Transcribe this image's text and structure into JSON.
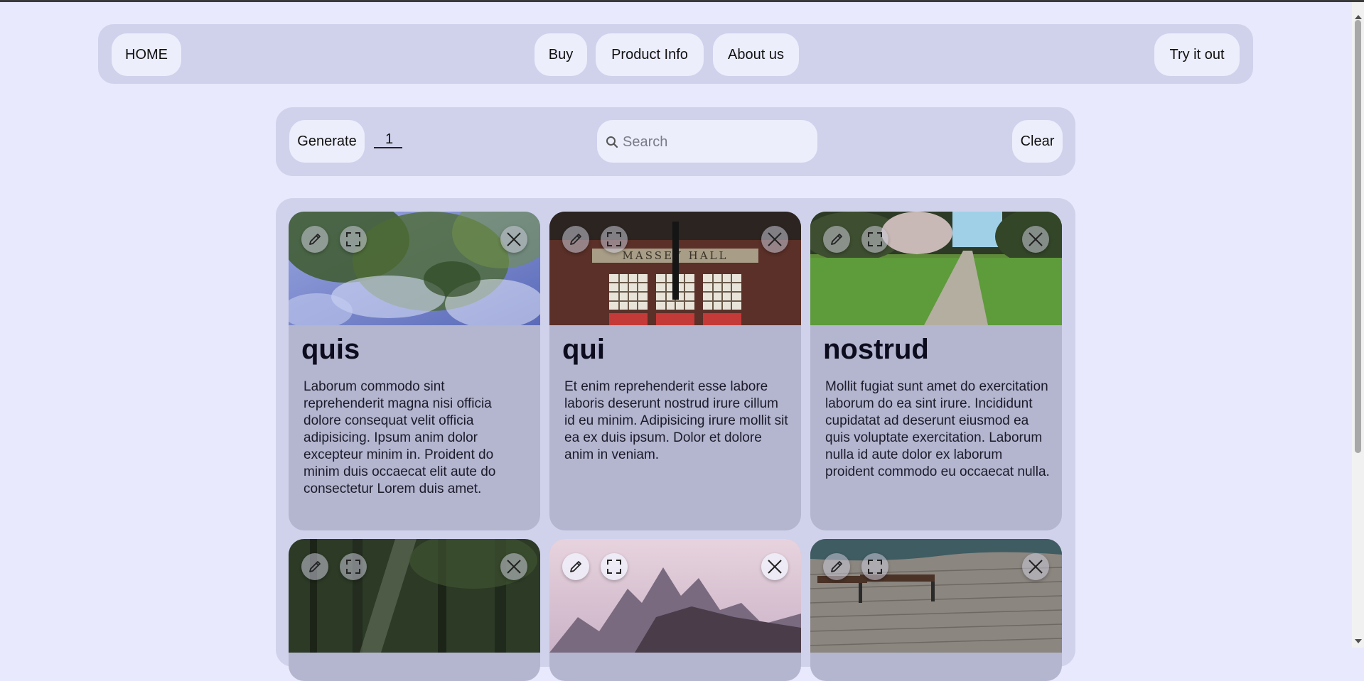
{
  "nav": {
    "home": "HOME",
    "buy": "Buy",
    "product_info": "Product Info",
    "about": "About us",
    "try": "Try it out"
  },
  "toolbar": {
    "generate_label": "Generate",
    "count_value": "1",
    "search_placeholder": "Search",
    "clear_label": "Clear"
  },
  "cards": [
    {
      "title": "quis",
      "body": "Laborum commodo sint reprehenderit magna nisi officia dolore consequat velit officia adipisicing. Ipsum anim dolor excepteur minim in. Proident do minim duis occaecat elit aute do consectetur Lorem duis amet."
    },
    {
      "title": "qui",
      "body": "Et enim reprehenderit esse labore laboris deserunt nostrud irure cillum id eu minim. Adipisicing irure mollit sit ea ex duis ipsum. Dolor et dolore anim in veniam.",
      "image_text": "MASSEY HALL"
    },
    {
      "title": "nostrud",
      "body": "Mollit fugiat sunt amet do exercitation laborum do ea sint irure. Incididunt cupidatat ad deserunt eiusmod ea quis voluptate exercitation. Laborum nulla id aute dolor ex laborum proident commodo eu occaecat nulla."
    },
    {
      "title": "",
      "body": ""
    },
    {
      "title": "",
      "body": ""
    },
    {
      "title": "",
      "body": ""
    }
  ],
  "icons": {
    "edit": "pencil-icon",
    "fullscreen": "fullscreen-icon",
    "close": "close-icon",
    "search": "search-icon"
  },
  "colors": {
    "background": "#e8e9fc",
    "panel": "#d0d2ec",
    "button": "#eceefc",
    "card": "#b4b5cf"
  }
}
